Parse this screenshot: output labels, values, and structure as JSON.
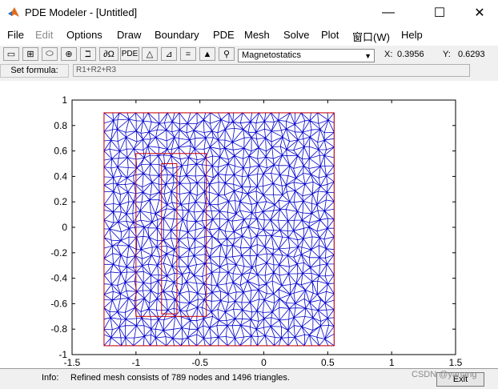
{
  "window": {
    "title": "PDE Modeler - [Untitled]",
    "controls": {
      "minimize": "—",
      "maximize": "☐",
      "close": "✕"
    }
  },
  "menu": [
    {
      "label": "File",
      "enabled": true
    },
    {
      "label": "Edit",
      "enabled": false
    },
    {
      "label": "Options",
      "enabled": true
    },
    {
      "label": "Draw",
      "enabled": true
    },
    {
      "label": "Boundary",
      "enabled": true
    },
    {
      "label": "PDE",
      "enabled": true
    },
    {
      "label": "Mesh",
      "enabled": true
    },
    {
      "label": "Solve",
      "enabled": true
    },
    {
      "label": "Plot",
      "enabled": true
    },
    {
      "label": "窗口(W)",
      "enabled": true
    },
    {
      "label": "Help",
      "enabled": true
    }
  ],
  "toolbar": {
    "buttons": [
      {
        "name": "draw-rectangle-icon",
        "glyph": "▭"
      },
      {
        "name": "draw-rectangle-centered-icon",
        "glyph": "⊞"
      },
      {
        "name": "draw-ellipse-icon",
        "glyph": "⬭"
      },
      {
        "name": "draw-ellipse-centered-icon",
        "glyph": "⊕"
      },
      {
        "name": "draw-polygon-icon",
        "glyph": "ℶ"
      },
      {
        "name": "boundary-mode-icon",
        "glyph": "∂Ω"
      },
      {
        "name": "pde-spec-icon",
        "glyph": "PDE"
      },
      {
        "name": "init-mesh-icon",
        "glyph": "△"
      },
      {
        "name": "refine-mesh-icon",
        "glyph": "⊿"
      },
      {
        "name": "solve-pde-icon",
        "glyph": "="
      },
      {
        "name": "plot-solution-icon",
        "glyph": "▲"
      },
      {
        "name": "zoom-icon",
        "glyph": "⚲"
      }
    ],
    "application": "Magnetostatics"
  },
  "coordinates": {
    "x_label": "X:",
    "x_value": "0.3956",
    "y_label": "Y:",
    "y_value": "0.6293"
  },
  "formula": {
    "label": "Set formula:",
    "value": "R1+R2+R3"
  },
  "chart_data": {
    "type": "mesh",
    "xlim": [
      -1.5,
      1.5
    ],
    "ylim": [
      -1,
      1
    ],
    "xticks": [
      -1.5,
      -1,
      -0.5,
      0,
      0.5,
      1,
      1.5
    ],
    "yticks": [
      -1,
      -0.8,
      -0.6,
      -0.4,
      -0.2,
      0,
      0.2,
      0.4,
      0.6,
      0.8,
      1
    ],
    "xtick_labels": [
      "-1.5",
      "-1",
      "-0.5",
      "0",
      "0.5",
      "1",
      "1.5"
    ],
    "ytick_labels": [
      "-1",
      "-0.8",
      "-0.6",
      "-0.4",
      "-0.2",
      "0",
      "0.2",
      "0.4",
      "0.6",
      "0.8",
      "1"
    ],
    "regions": [
      {
        "id": "R1",
        "xmin": -1.25,
        "xmax": 0.55,
        "ymin": -0.93,
        "ymax": 0.9
      },
      {
        "id": "R2",
        "xmin": -1.0,
        "xmax": -0.45,
        "ymin": -0.7,
        "ymax": 0.58
      },
      {
        "id": "R3",
        "xmin": -0.8,
        "xmax": -0.68,
        "ymin": -0.68,
        "ymax": 0.5
      }
    ],
    "mesh_nodes": 789,
    "mesh_triangles": 1496,
    "colors": {
      "mesh": "#0000cc",
      "boundary": "#cc0000",
      "axes": "#000000"
    }
  },
  "status": {
    "label": "Info:",
    "text": "Refined mesh consists of 789 nodes and 1496 triangles.",
    "exit": "Exit"
  },
  "watermark": "CSDN @yanang"
}
